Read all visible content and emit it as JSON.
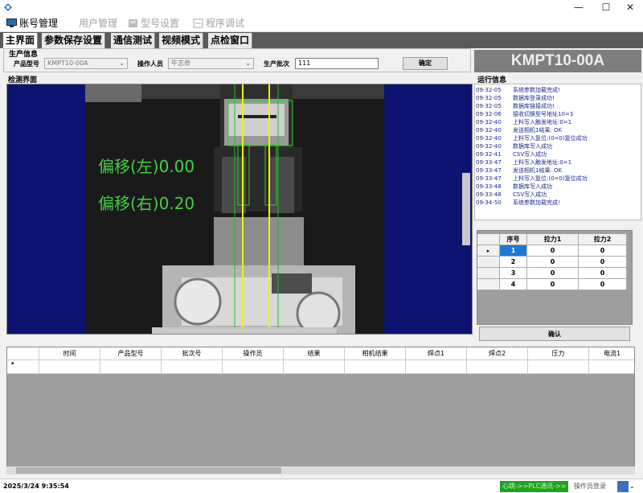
{
  "menu": {
    "account": "账号管理",
    "user": "用户管理",
    "model": "型号设置",
    "debug": "程序调试"
  },
  "tabs": [
    "主界面",
    "参数保存设置",
    "通信测试",
    "视频模式",
    "点检窗口"
  ],
  "production": {
    "title": "生产信息",
    "product_model_label": "产品型号",
    "product_model_value": "KMPT10-00A",
    "operator_label": "操作人员",
    "operator_value": "牛志奇",
    "batch_label": "生产批次",
    "batch_value": "111",
    "confirm": "确定"
  },
  "model_banner": "KMPT10-00A",
  "inspect": {
    "title": "检测界面",
    "offset_left": "偏移(左)0.00",
    "offset_right": "偏移(右)0.20"
  },
  "log": {
    "title": "运行信息",
    "lines": [
      {
        "t": "09-32-05",
        "m": "系统参数加载完成!"
      },
      {
        "t": "09-32-05",
        "m": "数据库登录成功!"
      },
      {
        "t": "09-32-05",
        "m": "数据库链接成功!"
      },
      {
        "t": "09-32-06",
        "m": "接收切换型号地址10=3"
      },
      {
        "t": "09-32-40",
        "m": "上料写入触发地址:0=1"
      },
      {
        "t": "09-32-40",
        "m": "发送相机1结果: OK"
      },
      {
        "t": "09-32-40",
        "m": "上料写入复位:(0=0)复位成功"
      },
      {
        "t": "09-32-40",
        "m": "数据库写入成功"
      },
      {
        "t": "09-32-41",
        "m": "CSV写入成功"
      },
      {
        "t": "09-33-47",
        "m": "上料写入触发地址:0=1"
      },
      {
        "t": "09-33-47",
        "m": "发送相机1结果: OK"
      },
      {
        "t": "09-33-47",
        "m": "上料写入复位:(0=0)复位成功"
      },
      {
        "t": "09-33-48",
        "m": "数据库写入成功"
      },
      {
        "t": "09-33-48",
        "m": "CSV写入成功"
      },
      {
        "t": "09-34-50",
        "m": "系统参数加载完成!"
      }
    ]
  },
  "force_grid": {
    "headers": [
      "序号",
      "拉力1",
      "拉力2"
    ],
    "rows": [
      [
        "1",
        "0",
        "0"
      ],
      [
        "2",
        "0",
        "0"
      ],
      [
        "3",
        "0",
        "0"
      ],
      [
        "4",
        "0",
        "0"
      ]
    ],
    "confirm": "确认"
  },
  "data_table": {
    "headers": [
      "时间",
      "产品型号",
      "批次号",
      "操作员",
      "结果",
      "相机结果",
      "焊点1",
      "焊点2",
      "压力",
      "电流1"
    ],
    "new_row_marker": "•"
  },
  "status": {
    "datetime": "2025/3/24 9:35:54",
    "plc_chain": "心跳->>PLC通讯->>",
    "operator_login": "操作员登录"
  },
  "colors": {
    "green_text": "#44d044",
    "log_text": "#1b2a8f",
    "banner_bg": "#7e7e7e",
    "inspect_bg": "#0d1370",
    "status_green": "#1fa31f"
  }
}
